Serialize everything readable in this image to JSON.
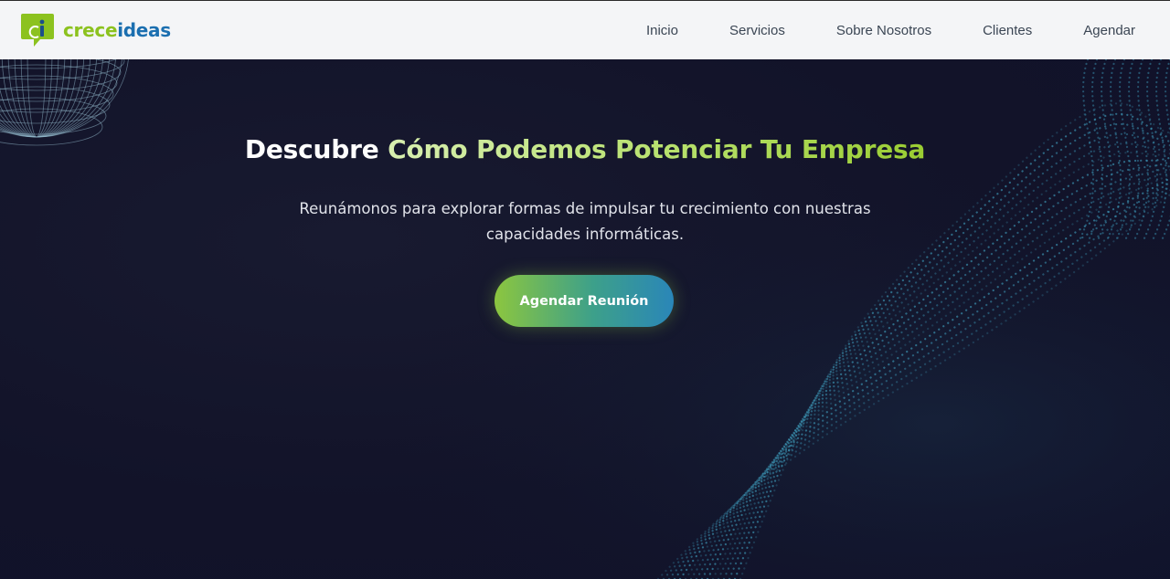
{
  "brand": {
    "name_part1": "crece",
    "name_part2": "ideas",
    "logo_icon": "speech-bubble-i-icon"
  },
  "nav": {
    "items": [
      {
        "label": "Inicio"
      },
      {
        "label": "Servicios"
      },
      {
        "label": "Sobre Nosotros"
      },
      {
        "label": "Clientes"
      },
      {
        "label": "Agendar"
      }
    ]
  },
  "hero": {
    "title_plain": "Descubre",
    "title_accent": "Cómo Podemos Potenciar Tu Empresa",
    "subtitle": "Reunámonos para explorar formas de impulsar tu crecimiento con nuestras capacidades informáticas.",
    "cta_label": "Agendar Reunión"
  },
  "colors": {
    "brand_green": "#8cc21f",
    "brand_blue": "#1b6fb0",
    "hero_background": "#12132a",
    "accent_text": "#b6e06a"
  }
}
